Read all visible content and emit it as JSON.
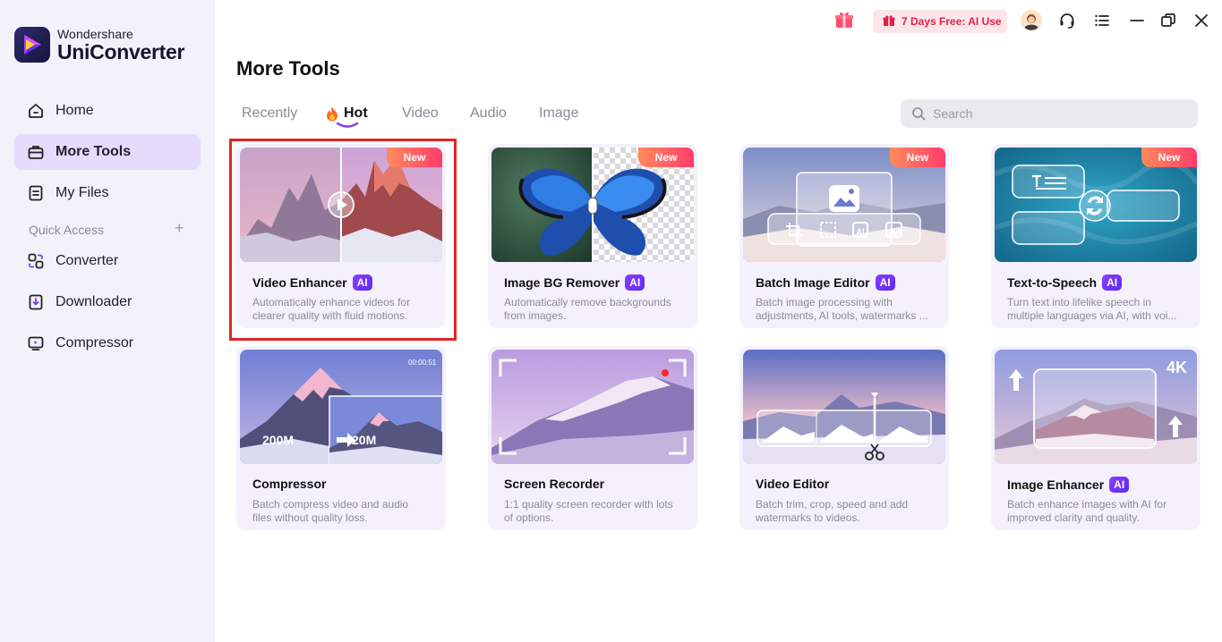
{
  "app": {
    "brand_sub": "Wondershare",
    "brand_main": "UniConverter",
    "promo": "7 Days Free: AI Use"
  },
  "sidebar": {
    "items": [
      {
        "label": "Home",
        "icon": "home-icon",
        "active": false
      },
      {
        "label": "More Tools",
        "icon": "toolbox-icon",
        "active": true
      },
      {
        "label": "My Files",
        "icon": "file-icon",
        "active": false
      }
    ],
    "quick_access_label": "Quick Access",
    "quick_items": [
      {
        "label": "Converter",
        "icon": "converter-icon"
      },
      {
        "label": "Downloader",
        "icon": "downloader-icon"
      },
      {
        "label": "Compressor",
        "icon": "compressor-icon"
      }
    ]
  },
  "main": {
    "title": "More Tools",
    "tabs": [
      {
        "label": "Recently",
        "active": false
      },
      {
        "label": "Hot",
        "active": true
      },
      {
        "label": "Video",
        "active": false
      },
      {
        "label": "Audio",
        "active": false
      },
      {
        "label": "Image",
        "active": false
      }
    ],
    "search_placeholder": "Search",
    "cards": [
      {
        "title": "Video Enhancer",
        "ai": true,
        "new": true,
        "new_label": "New",
        "desc": [
          "Automatically enhance videos for",
          "clearer quality with fluid motions."
        ]
      },
      {
        "title": "Image BG Remover",
        "ai": true,
        "new": true,
        "new_label": "New",
        "desc": [
          "Automatically remove backgrounds",
          "from images."
        ]
      },
      {
        "title": "Batch Image Editor",
        "ai": true,
        "new": true,
        "new_label": "New",
        "desc": [
          "Batch image processing with",
          "adjustments, AI tools, watermarks ..."
        ]
      },
      {
        "title": "Text-to-Speech",
        "ai": true,
        "new": true,
        "new_label": "New",
        "desc": [
          "Turn text into lifelike speech in",
          "multiple languages via AI, with voi..."
        ]
      },
      {
        "title": "Compressor",
        "ai": false,
        "new": false,
        "desc": [
          "Batch compress video and audio",
          "files without quality loss."
        ],
        "thumb_text": {
          "time": "00:00:51",
          "from": "200M",
          "to": "20M"
        }
      },
      {
        "title": "Screen Recorder",
        "ai": false,
        "new": false,
        "desc": [
          "1:1 quality screen recorder with lots",
          "of options."
        ]
      },
      {
        "title": "Video Editor",
        "ai": false,
        "new": false,
        "desc": [
          "Batch trim, crop, speed and add",
          "watermarks to videos."
        ]
      },
      {
        "title": "Image Enhancer",
        "ai": true,
        "new": false,
        "desc": [
          "Batch enhance images with AI for",
          "improved clarity and quality."
        ],
        "thumb_text": {
          "res": "4K"
        }
      }
    ],
    "ai_label": "AI"
  },
  "colors": {
    "accent": "#7b3cf0",
    "sidebar_bg": "#f3f2fb",
    "active_bg": "#e4dcfa",
    "card_bg": "#f4f1fd",
    "highlight": "#e02424"
  }
}
